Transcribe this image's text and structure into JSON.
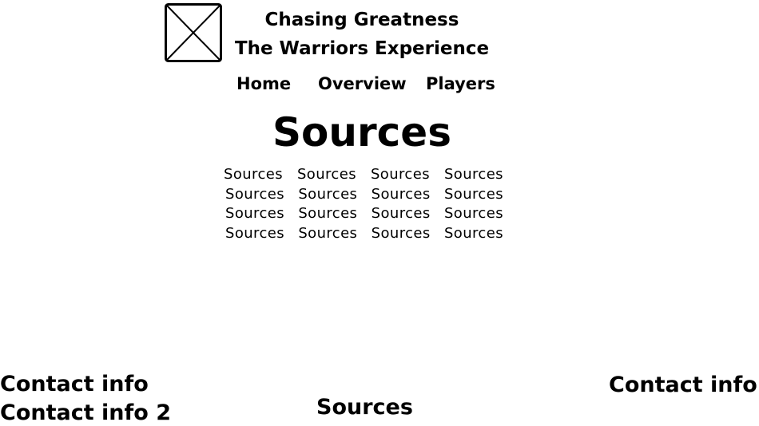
{
  "header": {
    "logo_icon": "image-placeholder-icon",
    "title_line_1": "Chasing Greatness",
    "title_line_2": "The Warriors Experience"
  },
  "nav": {
    "items": [
      {
        "label": "Home"
      },
      {
        "label": "Overview"
      },
      {
        "label": "Players"
      }
    ]
  },
  "main": {
    "heading": "Sources",
    "sources_rows": [
      [
        "Sources",
        "Sources",
        "Sources",
        "Sources"
      ],
      [
        "Sources",
        "Sources",
        "Sources",
        "Sources"
      ],
      [
        "Sources",
        "Sources",
        "Sources",
        "Sources"
      ],
      [
        "Sources",
        "Sources",
        "Sources",
        "Sources"
      ]
    ]
  },
  "footer": {
    "contact_left_1": "Contact info",
    "contact_left_2": "Contact info 2",
    "center_label": "Sources",
    "contact_right": "Contact info"
  }
}
